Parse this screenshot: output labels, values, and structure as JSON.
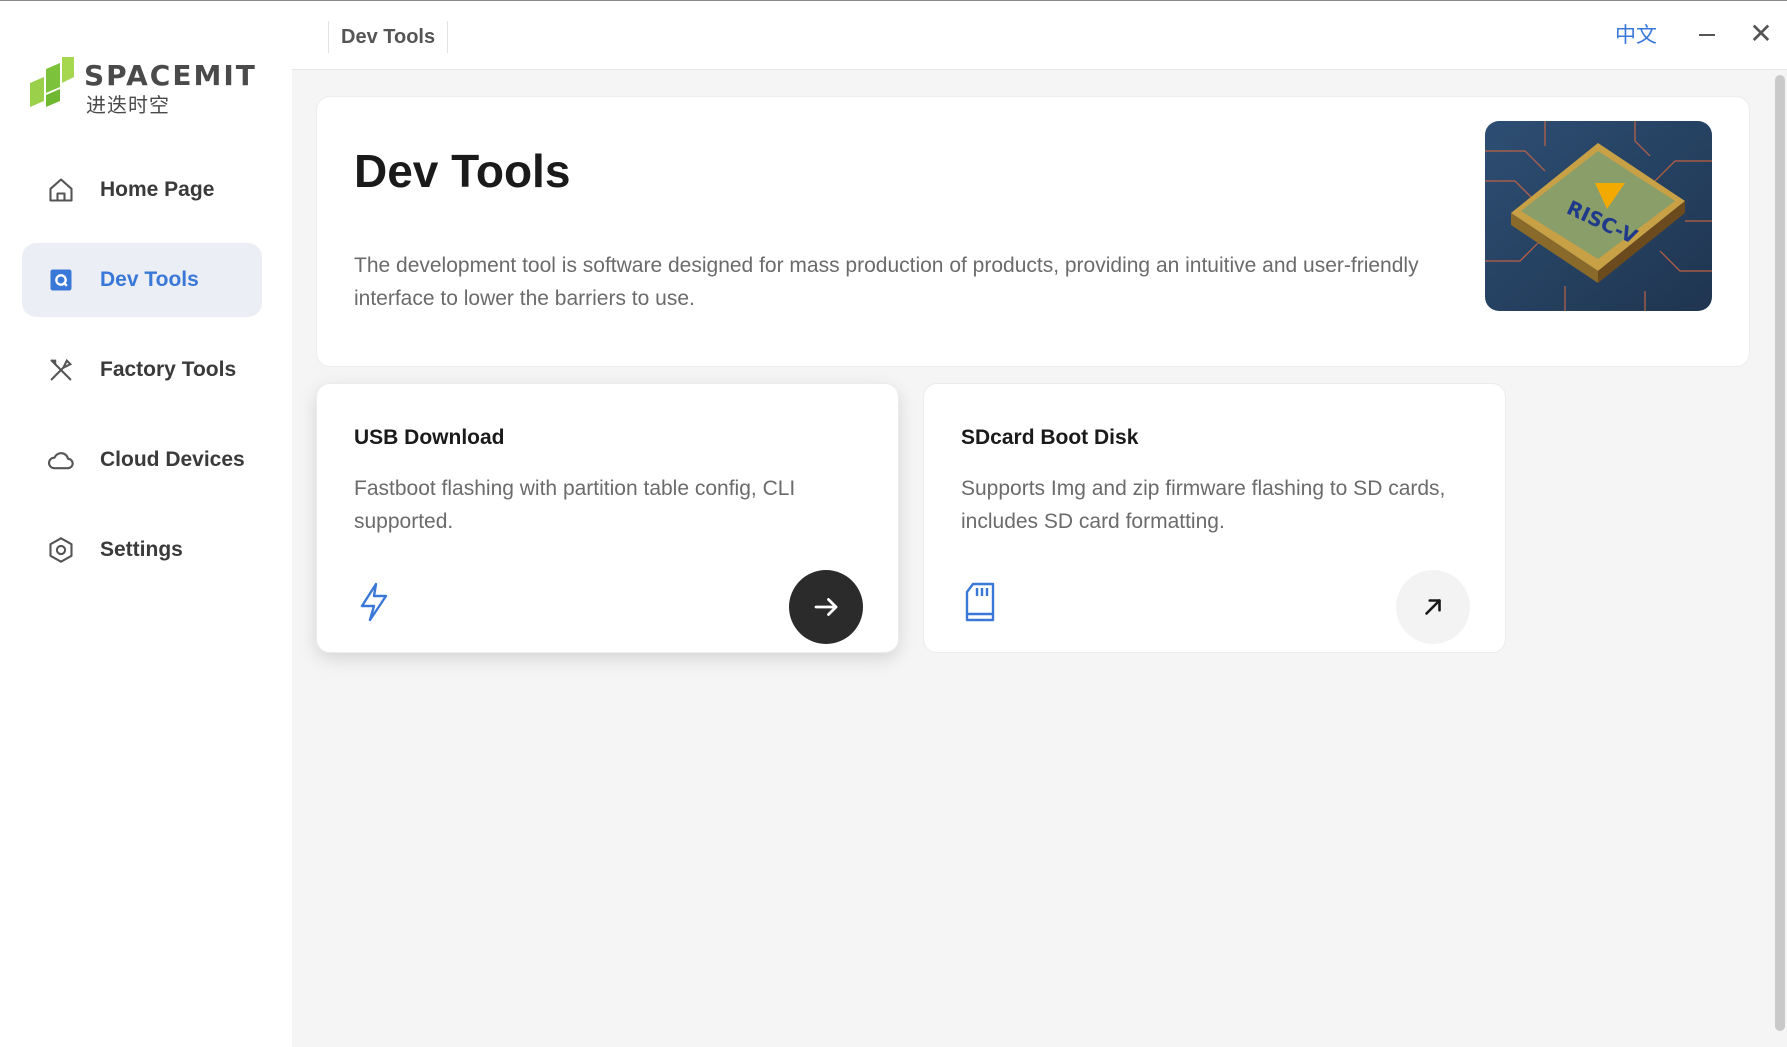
{
  "app": {
    "brand": "SPACEMIT",
    "brand_cn": "进迭时空",
    "accent_color": "#3a78d8"
  },
  "sidebar": {
    "items": [
      {
        "label": "Home Page",
        "icon": "home-icon",
        "active": false
      },
      {
        "label": "Dev Tools",
        "icon": "dev-tools-icon",
        "active": true
      },
      {
        "label": "Factory Tools",
        "icon": "tools-icon",
        "active": false
      },
      {
        "label": "Cloud Devices",
        "icon": "cloud-icon",
        "active": false
      },
      {
        "label": "Settings",
        "icon": "settings-icon",
        "active": false
      }
    ]
  },
  "titlebar": {
    "tab": "Dev Tools",
    "language": "中文",
    "minimize_icon": "minimize-icon",
    "close_icon": "close-icon",
    "close_glyph": "✕"
  },
  "hero": {
    "title": "Dev Tools",
    "description": "The development tool is software designed for mass production of products, providing an intuitive and user-friendly interface to lower the barriers to use.",
    "image_text": "RISC-V"
  },
  "cards": [
    {
      "title": "USB Download",
      "description": "Fastboot flashing with partition table config, CLI supported.",
      "icon": "lightning-icon",
      "action_icon": "arrow-right-icon"
    },
    {
      "title": "SDcard Boot Disk",
      "description": "Supports Img and zip firmware flashing to SD cards, includes SD card formatting.",
      "icon": "sd-card-icon",
      "action_icon": "arrow-up-right-icon"
    }
  ]
}
